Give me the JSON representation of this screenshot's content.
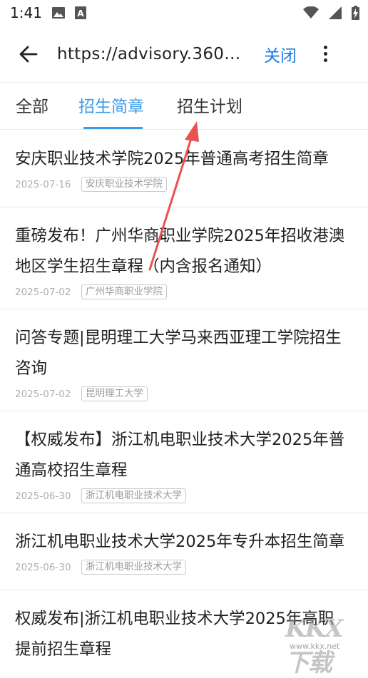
{
  "status_bar": {
    "time": "1:41"
  },
  "toolbar": {
    "url": "https://advisory.360eol.com/",
    "close_label": "关闭"
  },
  "tabs": [
    {
      "label": "全部",
      "active": false
    },
    {
      "label": "招生简章",
      "active": true
    },
    {
      "label": "招生计划",
      "active": false
    }
  ],
  "items": [
    {
      "title_lines": [
        "安庆职业技术学院2025年普通高考招生简章"
      ],
      "date": "2025-07-16",
      "tag": "安庆职业技术学院"
    },
    {
      "title_lines": [
        "重磅发布！广州华商职业学院2025年招收港澳",
        "地区学生招生章程（内含报名通知）"
      ],
      "date": "2025-07-02",
      "tag": "广州华商职业学院"
    },
    {
      "title_lines": [
        "问答专题|昆明理工大学马来西亚理工学院招生",
        "咨询"
      ],
      "date": "2025-07-02",
      "tag": "昆明理工大学"
    },
    {
      "title_lines": [
        "【权威发布】浙江机电职业技术大学2025年普",
        "通高校招生章程"
      ],
      "date": "2025-06-30",
      "tag": "浙江机电职业技术大学"
    },
    {
      "title_lines": [
        "浙江机电职业技术大学2025年专升本招生简章"
      ],
      "date": "2025-06-30",
      "tag": "浙江机电职业技术大学"
    },
    {
      "title_lines": [
        "权威发布|浙江机电职业技术大学2025年高职",
        "提前招生章程"
      ],
      "date": "",
      "tag": ""
    }
  ],
  "watermark": {
    "logo": "KKX下载",
    "url": "www.kkx.net"
  },
  "colors": {
    "accent": "#3a9ae8",
    "link": "#1e7be6",
    "annotation_arrow": "#e8534f"
  }
}
